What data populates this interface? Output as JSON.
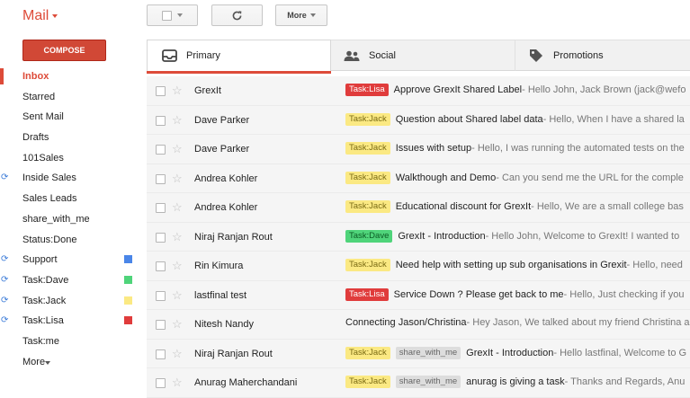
{
  "header": {
    "mail_title": "Mail",
    "more_label": "More"
  },
  "sidebar": {
    "compose_label": "COMPOSE",
    "items": [
      {
        "label": "Inbox",
        "active": true
      },
      {
        "label": "Starred"
      },
      {
        "label": "Sent Mail"
      },
      {
        "label": "Drafts"
      },
      {
        "label": "101Sales"
      },
      {
        "label": "Inside Sales",
        "sync": true
      },
      {
        "label": "Sales Leads"
      },
      {
        "label": "share_with_me"
      },
      {
        "label": "Status:Done"
      },
      {
        "label": "Support",
        "sync": true,
        "color": "#4a86e8"
      },
      {
        "label": "Task:Dave",
        "sync": true,
        "color": "#4fd47a"
      },
      {
        "label": "Task:Jack",
        "sync": true,
        "color": "#fbe983"
      },
      {
        "label": "Task:Lisa",
        "sync": true,
        "color": "#e03c3c"
      },
      {
        "label": "Task:me"
      },
      {
        "label": "More"
      }
    ]
  },
  "tabs": {
    "primary": "Primary",
    "social": "Social",
    "promotions": "Promotions"
  },
  "emails": [
    {
      "sender": "GrexIt",
      "labels": [
        {
          "text": "Task:Lisa",
          "type": "lisa"
        }
      ],
      "subject": "Approve GrexIt Shared Label",
      "snippet": " - Hello John, Jack Brown (jack@wefo"
    },
    {
      "sender": "Dave Parker",
      "labels": [
        {
          "text": "Task:Jack",
          "type": "jack"
        }
      ],
      "subject": "Question about Shared label data",
      "snippet": " - Hello, When I have a shared la"
    },
    {
      "sender": "Dave Parker",
      "labels": [
        {
          "text": "Task:Jack",
          "type": "jack"
        }
      ],
      "subject": "Issues with setup",
      "snippet": " - Hello, I was running the automated tests on the"
    },
    {
      "sender": "Andrea Kohler",
      "labels": [
        {
          "text": "Task:Jack",
          "type": "jack"
        }
      ],
      "subject": "Walkthough and Demo",
      "snippet": " - Can you send me the URL for the comple"
    },
    {
      "sender": "Andrea Kohler",
      "labels": [
        {
          "text": "Task:Jack",
          "type": "jack"
        }
      ],
      "subject": "Educational discount for GrexIt",
      "snippet": " - Hello, We are a small college bas"
    },
    {
      "sender": "Niraj Ranjan Rout",
      "labels": [
        {
          "text": "Task:Dave",
          "type": "dave"
        }
      ],
      "subject": "GrexIt - Introduction",
      "snippet": " - Hello John, Welcome to GrexIt! I wanted to"
    },
    {
      "sender": "Rin Kimura",
      "labels": [
        {
          "text": "Task:Jack",
          "type": "jack"
        }
      ],
      "subject": "Need help with setting up sub organisations in Grexit",
      "snippet": " - Hello, need"
    },
    {
      "sender": "lastfinal test",
      "labels": [
        {
          "text": "Task:Lisa",
          "type": "lisa"
        }
      ],
      "subject": "Service Down ? Please get back to me",
      "snippet": " - Hello, Just checking if you"
    },
    {
      "sender": "Nitesh Nandy",
      "labels": [],
      "subject": "Connecting Jason/Christina",
      "snippet": " - Hey Jason, We talked about my friend Christina a"
    },
    {
      "sender": "Niraj Ranjan Rout",
      "labels": [
        {
          "text": "Task:Jack",
          "type": "jack"
        },
        {
          "text": "share_with_me",
          "type": "share"
        }
      ],
      "subject": "GrexIt - Introduction",
      "snippet": " - Hello lastfinal, Welcome to G"
    },
    {
      "sender": "Anurag Maherchandani",
      "labels": [
        {
          "text": "Task:Jack",
          "type": "jack"
        },
        {
          "text": "share_with_me",
          "type": "share"
        }
      ],
      "subject": "anurag is giving a task",
      "snippet": " - Thanks and Regards, Anu"
    }
  ]
}
